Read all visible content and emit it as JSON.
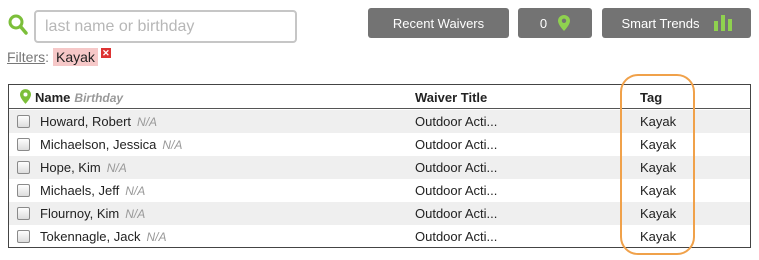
{
  "search": {
    "placeholder": "last name or birthday",
    "value": ""
  },
  "filters": {
    "label": "Filters",
    "active": [
      {
        "label": "Kayak",
        "remove_icon": "close-x-icon"
      }
    ]
  },
  "toolbar": {
    "recent_waivers_label": "Recent Waivers",
    "location_count": "0",
    "location_icon": "map-pin-icon",
    "smart_trends_label": "Smart Trends",
    "smart_trends_icon": "bar-chart-icon"
  },
  "table": {
    "columns": {
      "name": "Name",
      "birthday": "Birthday",
      "waiver_title": "Waiver Title",
      "tag": "Tag"
    },
    "rows": [
      {
        "name": "Howard, Robert",
        "birthday": "N/A",
        "waiver_title": "Outdoor Acti...",
        "tag": "Kayak"
      },
      {
        "name": "Michaelson, Jessica",
        "birthday": "N/A",
        "waiver_title": "Outdoor Acti...",
        "tag": "Kayak"
      },
      {
        "name": "Hope, Kim",
        "birthday": "N/A",
        "waiver_title": "Outdoor Acti...",
        "tag": "Kayak"
      },
      {
        "name": "Michaels, Jeff",
        "birthday": "N/A",
        "waiver_title": "Outdoor Acti...",
        "tag": "Kayak"
      },
      {
        "name": "Flournoy, Kim",
        "birthday": "N/A",
        "waiver_title": "Outdoor Acti...",
        "tag": "Kayak"
      },
      {
        "name": "Tokennagle, Jack",
        "birthday": "N/A",
        "waiver_title": "Outdoor Acti...",
        "tag": "Kayak"
      }
    ]
  },
  "colors": {
    "accent_green": "#7cbf3a",
    "button_gray": "#737373",
    "highlight_orange": "#f0a14a",
    "filter_chip": "#f6c8c8"
  }
}
